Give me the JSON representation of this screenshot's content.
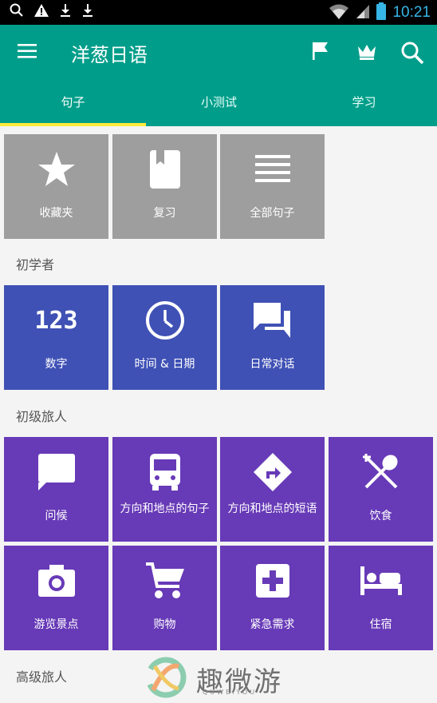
{
  "status": {
    "time": "10:21"
  },
  "app": {
    "title": "洋葱日语",
    "tabs": [
      "句子",
      "小测试",
      "学习"
    ]
  },
  "colors": {
    "appbar": "#009e8a",
    "indicator": "#ffeb3b",
    "gray": "#9e9e9e",
    "blue": "#3f51b5",
    "purple": "#673ab7"
  },
  "top_tiles": [
    {
      "label": "收藏夹",
      "icon": "star-icon"
    },
    {
      "label": "复习",
      "icon": "book-icon"
    },
    {
      "label": "全部句子",
      "icon": "list-icon"
    }
  ],
  "sections": [
    {
      "title": "初学者",
      "tiles": [
        {
          "label": "数字",
          "icon": "numbers-123-icon",
          "icon_text": "123"
        },
        {
          "label": "时间 & 日期",
          "icon": "clock-icon"
        },
        {
          "label": "日常对话",
          "icon": "chat-bubbles-icon"
        }
      ]
    },
    {
      "title": "初级旅人",
      "tiles": [
        {
          "label": "问候",
          "icon": "speech-bubble-icon"
        },
        {
          "label": "方向和地点的句子",
          "icon": "bus-icon"
        },
        {
          "label": "方向和地点的短语",
          "icon": "direction-sign-icon"
        },
        {
          "label": "饮食",
          "icon": "fork-spoon-icon"
        },
        {
          "label": "游览景点",
          "icon": "camera-icon"
        },
        {
          "label": "购物",
          "icon": "shopping-cart-icon"
        },
        {
          "label": "紧急需求",
          "icon": "medical-cross-icon"
        },
        {
          "label": "住宿",
          "icon": "bed-icon"
        }
      ]
    },
    {
      "title": "高级旅人",
      "tiles": []
    }
  ],
  "watermark": {
    "text": "趣微游",
    "sub": "QUWEIYOU"
  }
}
